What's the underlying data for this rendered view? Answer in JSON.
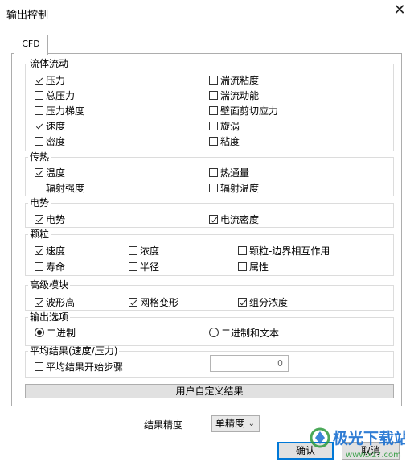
{
  "window": {
    "title": "输出控制",
    "close_glyph": "✕"
  },
  "tabs": [
    {
      "label": "CFD"
    }
  ],
  "groups": {
    "fluid_flow": {
      "label": "流体流动",
      "items": [
        {
          "label": "压力",
          "checked": true
        },
        {
          "label": "湍流粘度",
          "checked": false
        },
        {
          "label": "总压力",
          "checked": false
        },
        {
          "label": "湍流动能",
          "checked": false
        },
        {
          "label": "压力梯度",
          "checked": false
        },
        {
          "label": "壁面剪切应力",
          "checked": false
        },
        {
          "label": "速度",
          "checked": true
        },
        {
          "label": "旋涡",
          "checked": false
        },
        {
          "label": "密度",
          "checked": false
        },
        {
          "label": "粘度",
          "checked": false
        }
      ]
    },
    "heat_transfer": {
      "label": "传热",
      "items": [
        {
          "label": "温度",
          "checked": true
        },
        {
          "label": "热通量",
          "checked": false
        },
        {
          "label": "辐射强度",
          "checked": false
        },
        {
          "label": "辐射温度",
          "checked": false
        }
      ]
    },
    "electric_potential": {
      "label": "电势",
      "items": [
        {
          "label": "电势",
          "checked": true
        },
        {
          "label": "电流密度",
          "checked": true
        }
      ]
    },
    "particles": {
      "label": "颗粒",
      "items": [
        {
          "label": "速度",
          "checked": true
        },
        {
          "label": "浓度",
          "checked": false
        },
        {
          "label": "颗粒-边界相互作用",
          "checked": false
        },
        {
          "label": "寿命",
          "checked": false
        },
        {
          "label": "半径",
          "checked": false
        },
        {
          "label": "属性",
          "checked": false
        }
      ]
    },
    "advanced_modules": {
      "label": "高级模块",
      "items": [
        {
          "label": "波形高",
          "checked": true
        },
        {
          "label": "网格变形",
          "checked": true
        },
        {
          "label": "组分浓度",
          "checked": true
        }
      ]
    },
    "output_options": {
      "label": "输出选项",
      "options": [
        {
          "label": "二进制",
          "selected": true
        },
        {
          "label": "二进制和文本",
          "selected": false
        }
      ]
    },
    "average_results": {
      "label": "平均结果(速度/压力)",
      "checkbox": {
        "label": "平均结果开始步骤",
        "checked": false
      },
      "start_step_value": "0"
    }
  },
  "custom_results_button": "用户自定义结果",
  "precision": {
    "label": "结果精度",
    "value": "单精度"
  },
  "buttons": {
    "ok": "确认",
    "cancel": "取消"
  },
  "watermark": {
    "text": "极光下载站",
    "url_text": "www.xz7.com"
  },
  "colors": {
    "accent": "#0078d7",
    "watermark_green": "#2c9a3c",
    "watermark_blue": "#1a6fd0"
  }
}
